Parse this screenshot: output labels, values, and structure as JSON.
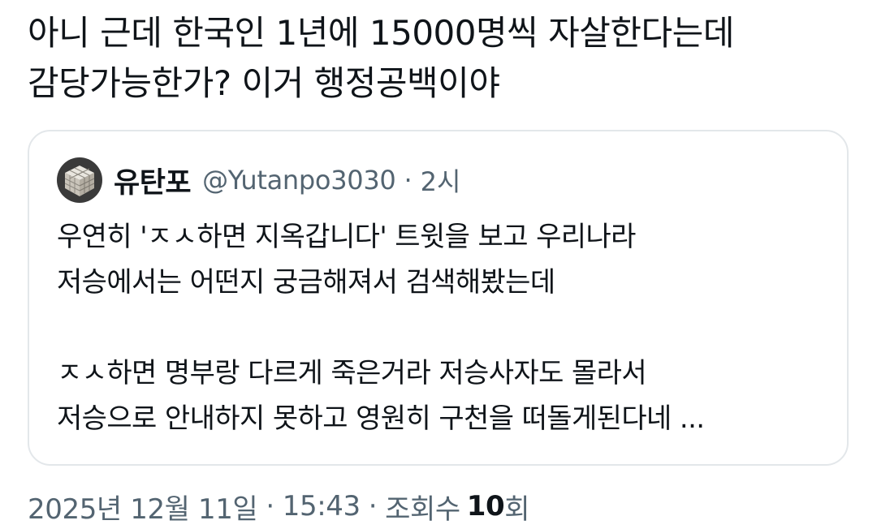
{
  "post": {
    "text": "아니 근데 한국인 1년에 15000명씩 자살한다는데\n감당가능한가?  이거 행정공백이야",
    "quote": {
      "avatar_icon": "dice-cube-avatar-icon",
      "display_name": "유탄포",
      "handle": "@Yutanpo3030",
      "separator": "·",
      "time": "2시",
      "lines": [
        "우연히 'ㅈㅅ하면 지옥갑니다' 트윗을 보고 우리나라",
        "저승에서는 어떤지 궁금해져서 검색해봤는데",
        "",
        "ㅈㅅ하면 명부랑 다르게 죽은거라 저승사자도 몰라서",
        "저승으로 안내하지 못하고 영원히 구천을 떠돌게된다네 ..."
      ]
    },
    "meta": {
      "date": "2025년 12월 11일",
      "separator": "·",
      "clock": "15:43",
      "views_label": "조회수",
      "views_count": "10",
      "views_unit": "회"
    }
  },
  "colors": {
    "text_primary": "#0f1419",
    "text_secondary": "#536471",
    "card_border": "#e3e7ea",
    "background": "#ffffff"
  }
}
